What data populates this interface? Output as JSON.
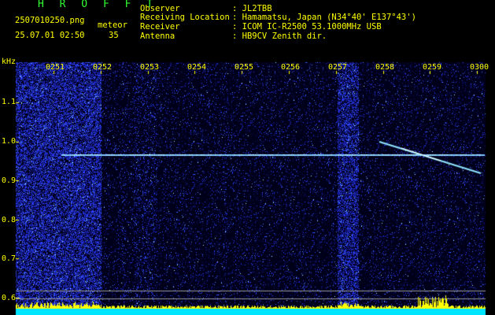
{
  "header": {
    "app_title": "H R O F F T",
    "filename": "2507010250.png",
    "timestamp": "25.07.01 02:50",
    "detection_label": "meteor",
    "detection_count": "35"
  },
  "station": {
    "rows": [
      {
        "label": "Observer",
        "value": ": JL2TBB"
      },
      {
        "label": "Receiving Location",
        "value": ": Hamamatsu, Japan (N34°40' E137°43')"
      },
      {
        "label": "Receiver",
        "value": ": ICOM IC-R2500 53.1000MHz USB"
      },
      {
        "label": "Antenna",
        "value": ": HB9CV Zenith dir."
      }
    ]
  },
  "axes": {
    "y_unit": "kHz",
    "time_ticks": [
      "0251",
      "0252",
      "0253",
      "0254",
      "0255",
      "0256",
      "0257",
      "0258",
      "0259",
      "0300"
    ],
    "freq_ticks": [
      "1.1",
      "1.0",
      "0.9",
      "0.8",
      "0.7",
      "0.6"
    ]
  },
  "colors": {
    "text_yellow": "#ffff00",
    "text_green": "#33ff33",
    "noise_blue": "#2b3fff",
    "echo_cyan": "#9fe8ff",
    "baseline_cyan": "#00e5ff"
  }
}
